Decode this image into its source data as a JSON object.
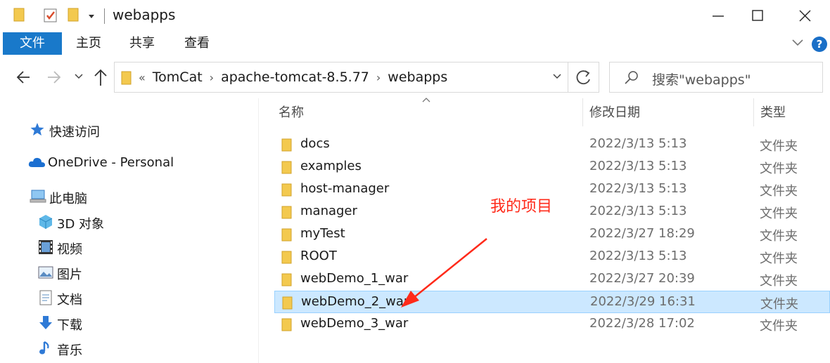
{
  "window": {
    "title": "webapps"
  },
  "ribbon": {
    "tabs": [
      "文件",
      "主页",
      "共享",
      "查看"
    ]
  },
  "address": {
    "overflow": "«",
    "crumbs": [
      "TomCat",
      "apache-tomcat-8.5.77",
      "webapps"
    ]
  },
  "search": {
    "placeholder": "搜索\"webapps\""
  },
  "sidebar": {
    "items": [
      {
        "label": "快速访问",
        "icon": "star-icon"
      },
      {
        "label": "OneDrive - Personal",
        "icon": "cloud-icon"
      },
      {
        "label": "此电脑",
        "icon": "computer-icon"
      },
      {
        "label": "3D 对象",
        "icon": "cube-icon"
      },
      {
        "label": "视频",
        "icon": "film-icon"
      },
      {
        "label": "图片",
        "icon": "picture-icon"
      },
      {
        "label": "文档",
        "icon": "document-icon"
      },
      {
        "label": "下载",
        "icon": "download-icon"
      },
      {
        "label": "音乐",
        "icon": "music-icon"
      }
    ]
  },
  "columns": {
    "name": "名称",
    "modified": "修改日期",
    "type": "类型"
  },
  "files": [
    {
      "name": "docs",
      "modified": "2022/3/13 5:13",
      "type": "文件夹"
    },
    {
      "name": "examples",
      "modified": "2022/3/13 5:13",
      "type": "文件夹"
    },
    {
      "name": "host-manager",
      "modified": "2022/3/13 5:13",
      "type": "文件夹"
    },
    {
      "name": "manager",
      "modified": "2022/3/13 5:13",
      "type": "文件夹"
    },
    {
      "name": "myTest",
      "modified": "2022/3/27 18:29",
      "type": "文件夹"
    },
    {
      "name": "ROOT",
      "modified": "2022/3/13 5:13",
      "type": "文件夹"
    },
    {
      "name": "webDemo_1_war",
      "modified": "2022/3/27 20:39",
      "type": "文件夹"
    },
    {
      "name": "webDemo_2_war",
      "modified": "2022/3/29 16:31",
      "type": "文件夹",
      "selected": true
    },
    {
      "name": "webDemo_3_war",
      "modified": "2022/3/28 17:02",
      "type": "文件夹"
    }
  ],
  "annotation": {
    "text": "我的项目"
  },
  "colors": {
    "accent": "#1979ca",
    "selection": "#cce8ff",
    "annotation": "#ff2a1a",
    "folder": "#f8d05c"
  }
}
